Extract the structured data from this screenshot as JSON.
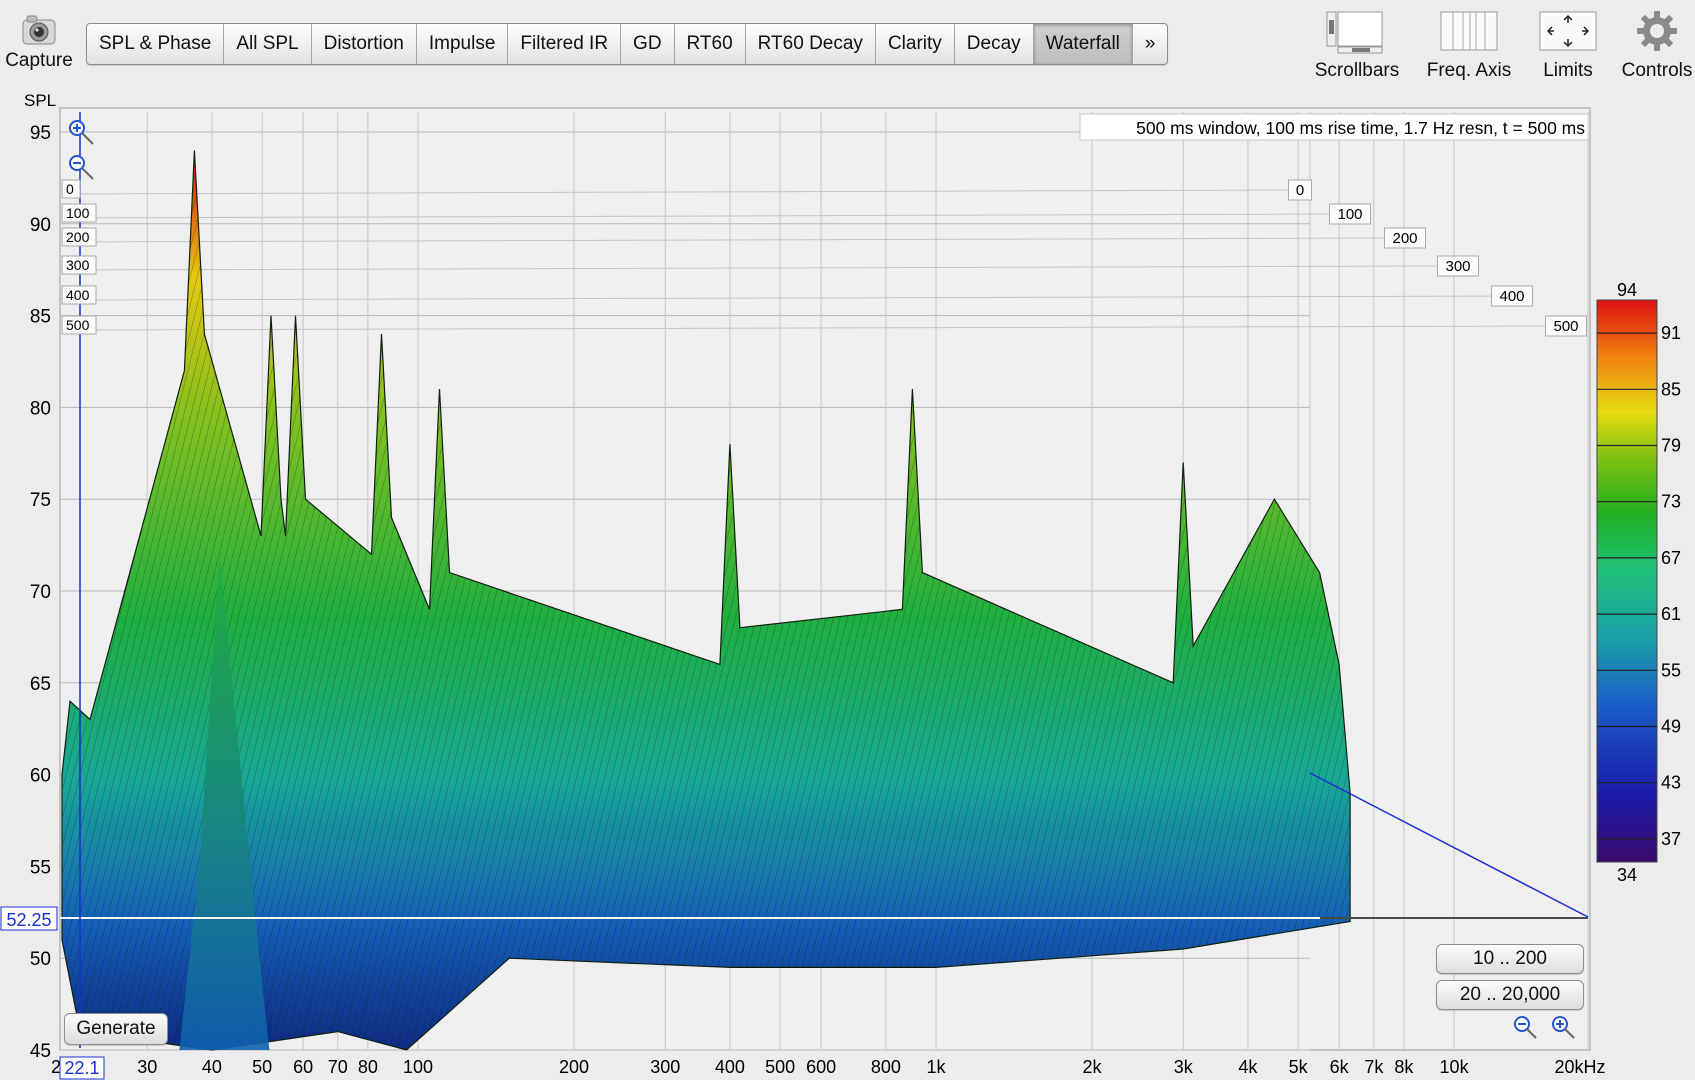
{
  "toolbar": {
    "capture_label": "Capture",
    "tabs": [
      {
        "label": "SPL & Phase",
        "active": false
      },
      {
        "label": "All SPL",
        "active": false
      },
      {
        "label": "Distortion",
        "active": false
      },
      {
        "label": "Impulse",
        "active": false
      },
      {
        "label": "Filtered IR",
        "active": false
      },
      {
        "label": "GD",
        "active": false
      },
      {
        "label": "RT60",
        "active": false
      },
      {
        "label": "RT60 Decay",
        "active": false
      },
      {
        "label": "Clarity",
        "active": false
      },
      {
        "label": "Decay",
        "active": false
      },
      {
        "label": "Waterfall",
        "active": true
      }
    ],
    "more_label": "»",
    "tools": {
      "scrollbars": "Scrollbars",
      "freq_axis": "Freq. Axis",
      "limits": "Limits",
      "controls": "Controls"
    }
  },
  "plot": {
    "y_axis_title": "SPL",
    "info_text": "500 ms window, 100 ms rise time,  1.7 Hz resn, t = 500 ms",
    "cursor_value": "52.25",
    "cursor_freq": "22.1",
    "x_axis_start_label": "2",
    "y_ticks": [
      "95",
      "90",
      "85",
      "80",
      "75",
      "70",
      "65",
      "60",
      "55",
      "50",
      "45"
    ],
    "x_ticks": [
      "30",
      "40",
      "50",
      "60",
      "70",
      "80",
      "100",
      "200",
      "300",
      "400",
      "500",
      "600",
      "800",
      "1k",
      "2k",
      "3k",
      "4k",
      "5k",
      "6k",
      "7k",
      "8k",
      "10k",
      "20kHz"
    ],
    "time_ticks": [
      "0",
      "100",
      "200",
      "300",
      "400",
      "500"
    ],
    "generate_label": "Generate",
    "range_buttons": [
      "10 .. 200",
      "20 .. 20,000"
    ]
  },
  "colorbar": {
    "max_label": "94",
    "min_label": "34",
    "ticks": [
      "91",
      "85",
      "79",
      "73",
      "67",
      "61",
      "55",
      "49",
      "43",
      "37"
    ],
    "colors": [
      "#3a0a6e",
      "#1a1aa8",
      "#1a5ec8",
      "#1aa0a8",
      "#20c078",
      "#20b020",
      "#80c010",
      "#e6dc10",
      "#f08010",
      "#e01010"
    ]
  },
  "chart_data": {
    "type": "waterfall",
    "y_label": "SPL",
    "ylim": [
      45,
      95
    ],
    "x_scale": "log",
    "x_range_hz": [
      20,
      20000
    ],
    "time_range_ms": [
      0,
      500
    ],
    "color_range": [
      34,
      94
    ],
    "peaks": [
      {
        "freq_hz": 37,
        "spl": 94
      },
      {
        "freq_hz": 52,
        "spl": 85
      },
      {
        "freq_hz": 58,
        "spl": 85
      },
      {
        "freq_hz": 85,
        "spl": 84
      },
      {
        "freq_hz": 110,
        "spl": 81
      },
      {
        "freq_hz": 400,
        "spl": 78
      },
      {
        "freq_hz": 900,
        "spl": 81
      },
      {
        "freq_hz": 3000,
        "spl": 77
      }
    ]
  }
}
